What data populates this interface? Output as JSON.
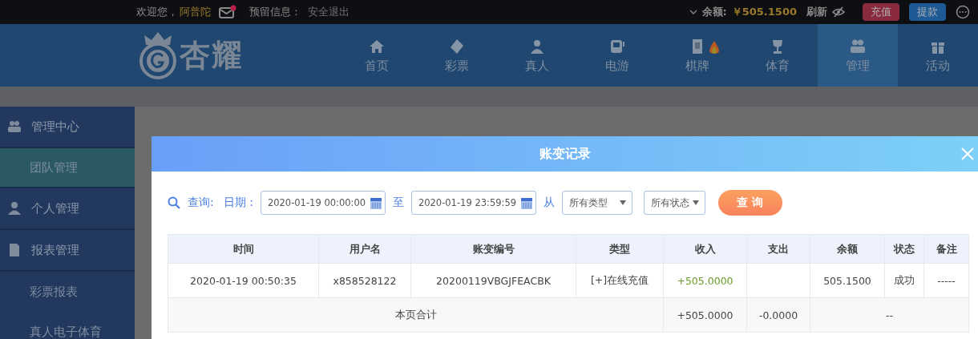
{
  "top_bar": {
    "greeting": "欢迎您，",
    "username": "阿普陀",
    "mail_unread": true,
    "reserved_info_label": "预留信息：",
    "logout": "安全退出",
    "balance_label": "余额:",
    "balance": "￥505.1500",
    "refresh": "刷新",
    "deposit": "充值",
    "withdraw": "提款"
  },
  "logo": {
    "text": "杏耀"
  },
  "nav": [
    {
      "label": "首页",
      "selected": false,
      "hot": false
    },
    {
      "label": "彩票",
      "selected": false,
      "hot": false
    },
    {
      "label": "真人",
      "selected": false,
      "hot": false
    },
    {
      "label": "电游",
      "selected": false,
      "hot": false
    },
    {
      "label": "棋牌",
      "selected": false,
      "hot": true
    },
    {
      "label": "体育",
      "selected": false,
      "hot": false
    },
    {
      "label": "管理",
      "selected": true,
      "hot": false
    },
    {
      "label": "活动",
      "selected": false,
      "hot": false
    }
  ],
  "sidebar": [
    {
      "label": "管理中心",
      "children": [
        {
          "label": "团队管理",
          "selected": true
        }
      ]
    },
    {
      "label": "个人管理"
    },
    {
      "label": "报表管理",
      "children": [
        {
          "label": "彩票报表",
          "selected": false
        },
        {
          "label": "真人电子体育",
          "selected": false
        }
      ]
    }
  ],
  "modal": {
    "title": "账变记录",
    "filter": {
      "query_label": "查询:",
      "date_label": "日期 :",
      "start": "2020-01-19 00:00:00",
      "to_label": "至",
      "end": "2020-01-19 23:59:59",
      "from_label": "从",
      "type": "所有类型",
      "status": "所有状态",
      "search_button": "查 询"
    },
    "table": {
      "columns": [
        "时间",
        "用户名",
        "账变编号",
        "类型",
        "收入",
        "支出",
        "余额",
        "状态",
        "备注"
      ],
      "rows": [
        [
          "2020-01-19 00:50:35",
          "x858528122",
          "20200119VBGJFEACBK",
          "[+]在线充值",
          "+505.0000",
          null,
          "505.1500",
          "成功",
          "-----"
        ]
      ],
      "total": {
        "label": "本页合计",
        "income": "+505.0000",
        "expense": "-0.0000",
        "balance": "--"
      }
    }
  }
}
